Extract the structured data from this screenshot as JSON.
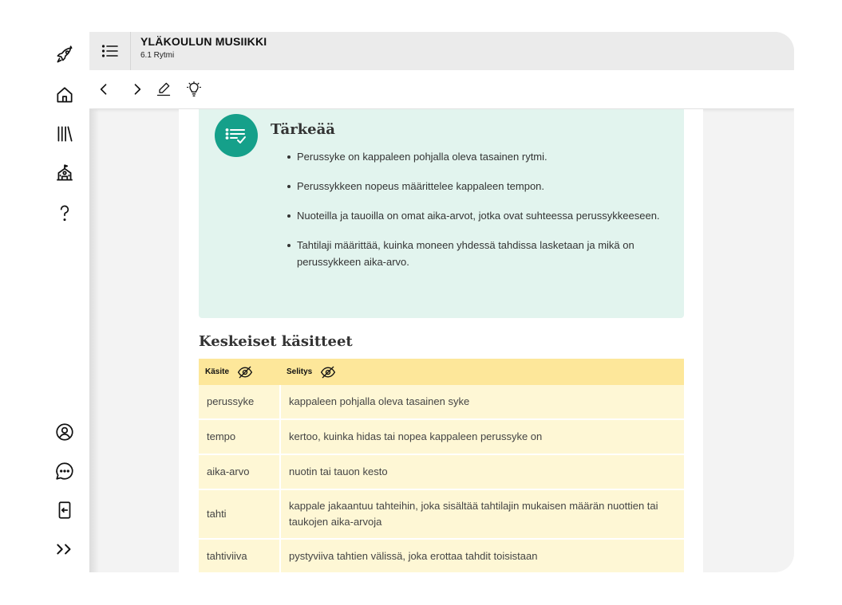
{
  "header": {
    "book_title": "YLÄKOULUN MUSIIKKI",
    "chapter": "6.1 Rytmi"
  },
  "rail": {
    "icons": [
      "rocket-icon",
      "home-icon",
      "library-icon",
      "school-icon",
      "help-icon",
      "profile-icon",
      "chat-icon",
      "logout-icon",
      "expand-icon"
    ]
  },
  "toolbar": {
    "icons": [
      "chevron-left-icon",
      "chevron-right-icon",
      "highlighter-icon",
      "lightbulb-icon"
    ]
  },
  "callout": {
    "title": "Tärkeää",
    "bullets": [
      "Perussyke on kappaleen pohjalla oleva tasainen rytmi.",
      "Perussykkeen nopeus määrittelee kappaleen tempon.",
      "Nuoteilla ja tauoilla on omat aika-arvot, jotka ovat suhteessa perussykkeeseen.",
      "Tahtilaji määrittää, kuinka moneen yhdessä tahdissa lasketaan ja mikä on perussykkeen aika-arvo."
    ]
  },
  "concepts": {
    "title": "Keskeiset käsitteet",
    "headers": [
      "Käsite",
      "Selitys"
    ],
    "rows": [
      {
        "term": "perussyke",
        "definition": "kappaleen pohjalla oleva tasainen syke"
      },
      {
        "term": "tempo",
        "definition": "kertoo, kuinka hidas tai nopea kappaleen perussyke on"
      },
      {
        "term": "aika-arvo",
        "definition": "nuotin tai tauon kesto"
      },
      {
        "term": "tahti",
        "definition": "kappale jakaantuu tahteihin, joka sisältää tahtilajin mukaisen määrän nuottien tai taukojen aika-arvoja"
      },
      {
        "term": "tahtiviiva",
        "definition": "pystyviiva tahtien välissä, joka erottaa tahdit toisistaan"
      }
    ]
  },
  "colors": {
    "accent": "#15a08a",
    "callout_bg": "#e2f4ee",
    "table_header": "#fde79a",
    "table_row": "#fef7d5"
  }
}
